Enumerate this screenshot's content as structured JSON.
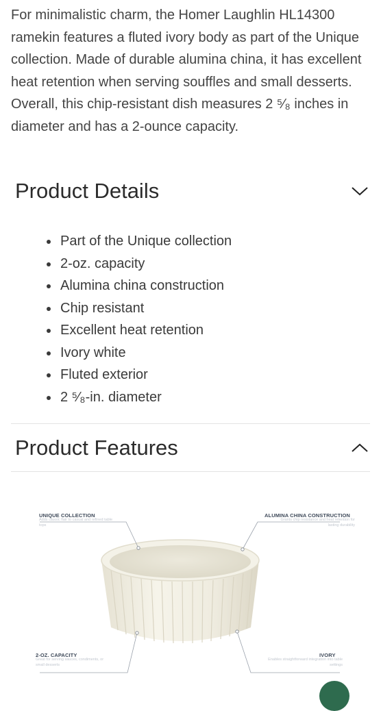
{
  "description": "For minimalistic charm, the Homer Laughlin HL14300 ramekin features a fluted ivory body as part of the Unique collection. Made of durable alumina china, it has excellent heat retention when serving souffles and small desserts. Overall, this chip-resistant dish measures 2 ⁵⁄₈ inches in diameter and has a 2-ounce capacity.",
  "product_details": {
    "title": "Product Details",
    "toggle_icon": "chevron-down-icon",
    "items": [
      "Part of the Unique collection",
      "2-oz. capacity",
      "Alumina china construction",
      "Chip resistant",
      "Excellent heat retention",
      "Ivory white",
      "Fluted exterior",
      "2 ⁵⁄₈-in. diameter"
    ]
  },
  "product_features": {
    "title": "Product Features",
    "toggle_icon": "chevron-up-icon",
    "callouts": {
      "top_left": {
        "title": "UNIQUE COLLECTION",
        "text": "Adds classic flair to casual and refined table tops"
      },
      "top_right": {
        "title": "ALUMINA CHINA CONSTRUCTION",
        "text": "Grants chip resistance and heat retention for lasting durability"
      },
      "bottom_left": {
        "title": "2-OZ. CAPACITY",
        "text": "Great for serving sauces, condiments, or small desserts"
      },
      "bottom_right": {
        "title": "IVORY",
        "text": "Enables straightforward integration into table settings"
      }
    }
  },
  "colors": {
    "text": "#444444",
    "heading": "#2b2b2b",
    "divider": "#e3e3e3",
    "callout_title": "#3f4a5a",
    "chat_button": "#2e6b4e"
  }
}
